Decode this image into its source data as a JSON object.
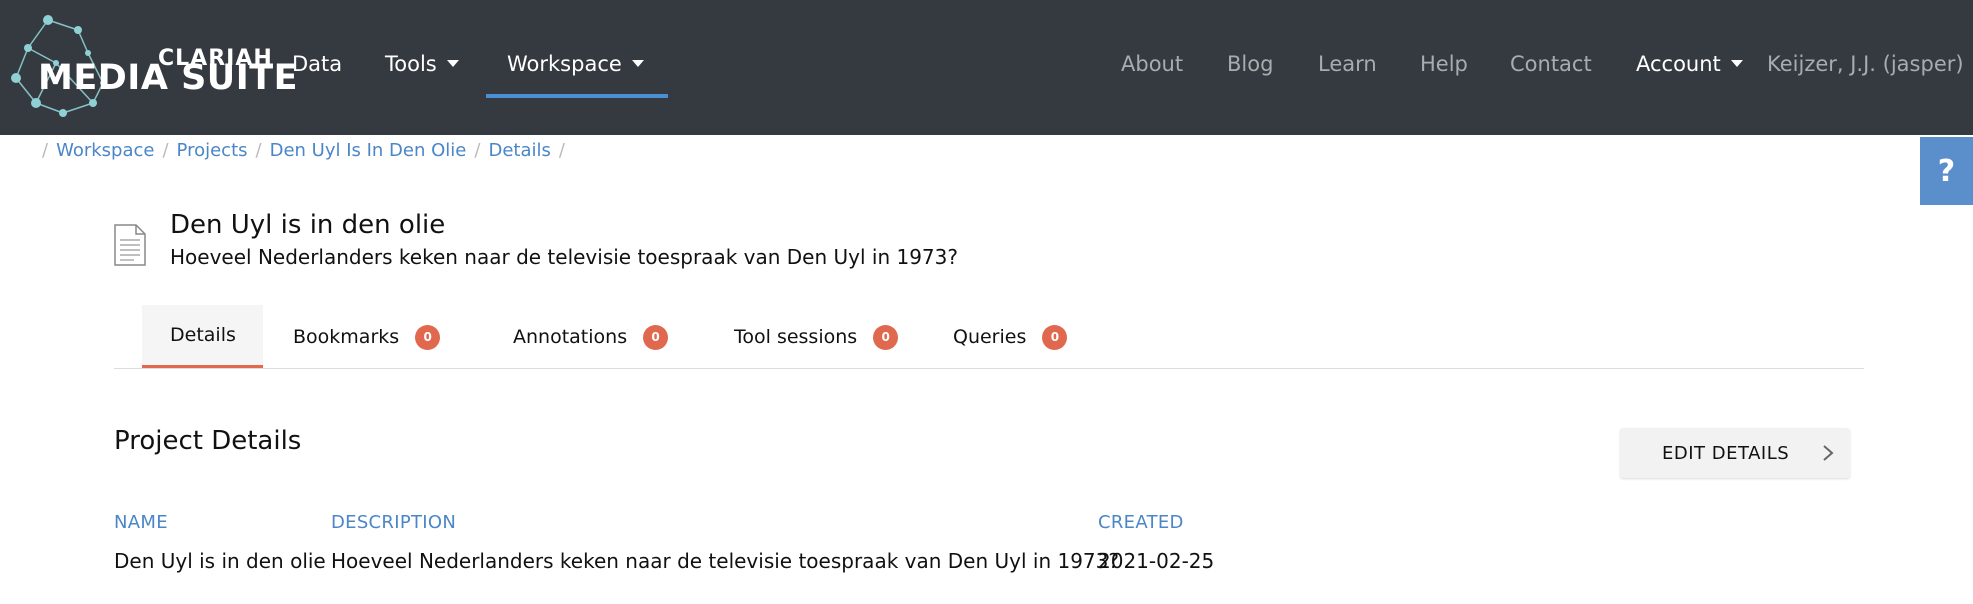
{
  "brand": {
    "name_top": "CLARIAH",
    "name_bottom": "MEDIA SUITE",
    "logo_icon": "network-nodes-icon"
  },
  "nav": {
    "left": [
      {
        "label": "Data"
      },
      {
        "label": "Tools"
      },
      {
        "label": "Workspace"
      }
    ],
    "right": [
      {
        "label": "About"
      },
      {
        "label": "Blog"
      },
      {
        "label": "Learn"
      },
      {
        "label": "Help"
      },
      {
        "label": "Contact"
      },
      {
        "label": "Account"
      }
    ],
    "user": "Keijzer, J.J. (jasper)"
  },
  "breadcrumb": [
    "Workspace",
    "Projects",
    "Den Uyl Is In Den Olie",
    "Details"
  ],
  "help_tab": "?",
  "project": {
    "title": "Den Uyl is in den olie",
    "subtitle": "Hoeveel Nederlanders keken naar de televisie toespraak van Den Uyl in 1973?",
    "icon": "document-icon"
  },
  "tabs": [
    {
      "label": "Details",
      "active": true
    },
    {
      "label": "Bookmarks",
      "count": "0"
    },
    {
      "label": "Annotations",
      "count": "0"
    },
    {
      "label": "Tool sessions",
      "count": "0"
    },
    {
      "label": "Queries",
      "count": "0"
    }
  ],
  "details": {
    "section_title": "Project Details",
    "edit_label": "EDIT DETAILS",
    "columns": {
      "name": {
        "header": "NAME",
        "value": "Den Uyl is in den olie"
      },
      "description": {
        "header": "DESCRIPTION",
        "value": "Hoeveel Nederlanders keken naar de televisie toespraak van Den Uyl in 1973?"
      },
      "created": {
        "header": "CREATED",
        "value": "2021-02-25"
      }
    }
  },
  "colors": {
    "navbar": "#343a40",
    "accent": "#4a86c8",
    "badge": "#e0684e",
    "help_tab": "#5b8fcc"
  }
}
